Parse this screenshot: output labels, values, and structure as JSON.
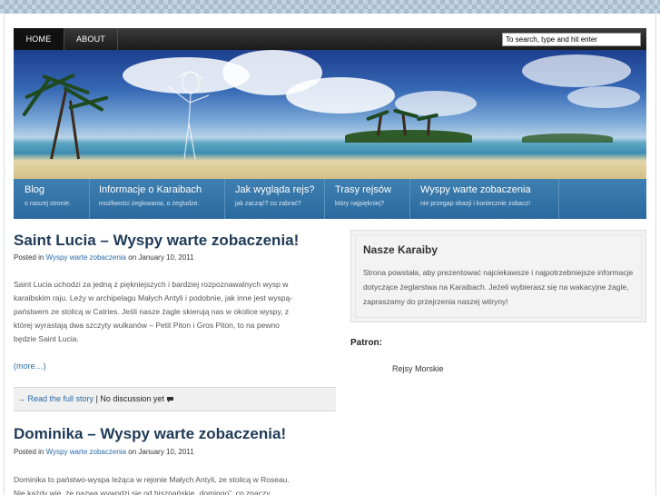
{
  "topnav": {
    "items": [
      "HOME",
      "ABOUT"
    ],
    "search_placeholder": "To search, type and hit enter"
  },
  "catnav": {
    "items": [
      {
        "title": "Blog",
        "sub": "o naszej stronie."
      },
      {
        "title": "Informacje o Karaibach",
        "sub": "możliwości żeglowania, o żegludze."
      },
      {
        "title": "Jak wygląda rejs?",
        "sub": "jak zacząć? co zabrać?"
      },
      {
        "title": "Trasy rejsów",
        "sub": "który najpiękniej?"
      },
      {
        "title": "Wyspy warte zobaczenia",
        "sub": "nie przegap okazji i koniecznie zobacz!"
      }
    ]
  },
  "posts": [
    {
      "title": "Saint Lucia – Wyspy warte zobaczenia!",
      "meta_prefix": "Posted in",
      "category": "Wyspy warte zobaczenia",
      "meta_on": "on January 10, 2011",
      "body": [
        "Saint Lucia uchodzi za jedną z piękniejszych i bardziej rozpoznawalnych wysp w",
        "karaibskim raju. Leży w archipelagu Małych Antyli i podobnie, jak inne jest wyspą-",
        "państwem ze stolicą w Catries. Jeśli nasze żagle skierują nas w okolice wyspy, z",
        "której wyrastają dwa szczyty wulkanów – Petit Piton i Gros Piton, to na pewno",
        "będzie Saint Lucia."
      ],
      "more": "(more…)",
      "full_story": "→ Read the full story",
      "discussion": "| No discussion yet"
    },
    {
      "title": "Dominika – Wyspy warte zobaczenia!",
      "meta_prefix": "Posted in",
      "category": "Wyspy warte zobaczenia",
      "meta_on": "on January 10, 2011",
      "body": [
        "Dominika to państwo-wyspa leżąca w rejonie Małych Antyli, ze stolicą w Roseau.",
        "Nie każdy wie, że nazwa wywodzi się od hiszpańskie „domingo”, co znaczy"
      ]
    }
  ],
  "sidebar": {
    "title": "Nasze Karaiby",
    "text": "Strona powstała, aby prezentować najciekawsze i najpotrzebniejsze informacje dotyczące żeglarstwa na Karaibach. Jeżeli wybierasz się na wakacyjne żagle, zapraszamy do przejrzenia naszej witryny!",
    "patron_label": "Patron:",
    "patron_link": "Rejsy Morskie"
  },
  "colors": {
    "accent": "#2a6aa8",
    "catnav": "#3a78aa",
    "title": "#1f3a57"
  }
}
